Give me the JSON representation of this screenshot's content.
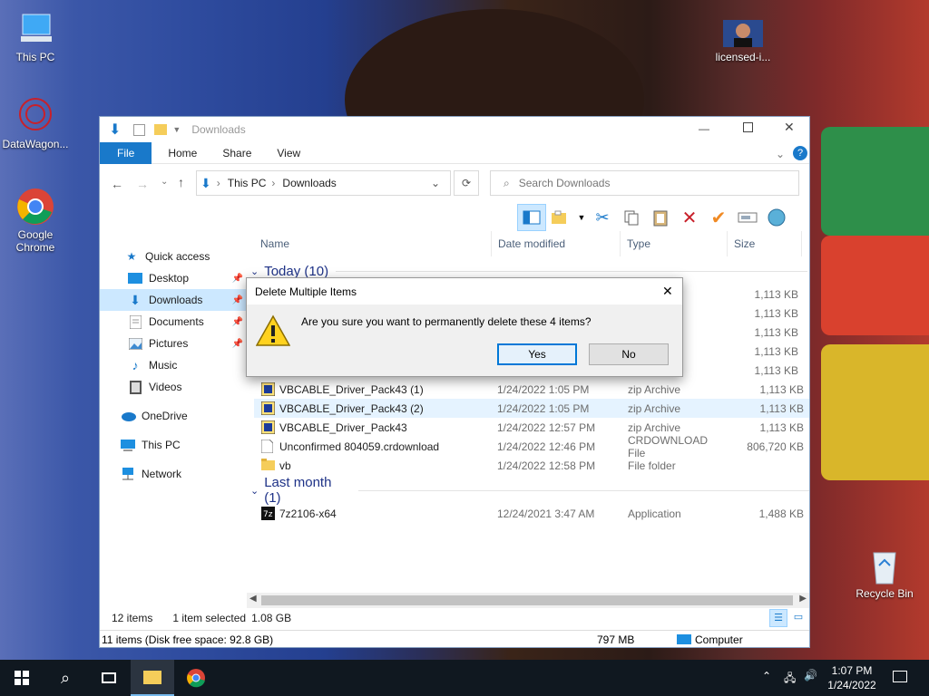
{
  "desktop": {
    "icons": [
      {
        "label": "This PC"
      },
      {
        "label": "DataWagon..."
      },
      {
        "label": "Google Chrome"
      },
      {
        "label": "licensed-i..."
      },
      {
        "label": "Recycle Bin"
      }
    ]
  },
  "explorer": {
    "title": "Downloads",
    "tabs": [
      "File",
      "Home",
      "Share",
      "View"
    ],
    "breadcrumb": [
      "This PC",
      "Downloads"
    ],
    "search_placeholder": "Search Downloads",
    "nav": [
      {
        "label": "Quick access",
        "icon": "star-icon"
      },
      {
        "label": "Desktop",
        "icon": "desktop-icon"
      },
      {
        "label": "Downloads",
        "icon": "download-icon"
      },
      {
        "label": "Documents",
        "icon": "documents-icon"
      },
      {
        "label": "Pictures",
        "icon": "pictures-icon"
      },
      {
        "label": "Music",
        "icon": "music-icon"
      },
      {
        "label": "Videos",
        "icon": "videos-icon"
      },
      {
        "label": "OneDrive",
        "icon": "cloud-icon"
      },
      {
        "label": "This PC",
        "icon": "computer-icon"
      },
      {
        "label": "Network",
        "icon": "network-icon"
      }
    ],
    "columns": [
      "Name",
      "Date modified",
      "Type",
      "Size"
    ],
    "group_today": "Today (10)",
    "group_last_month": "Last month (1)",
    "hidden_sizes": [
      "1,113 KB",
      "1,113 KB",
      "1,113 KB",
      "1,113 KB",
      "1,113 KB"
    ],
    "files": [
      {
        "name": "VBCABLE_Driver_Pack43 (1)",
        "date": "1/24/2022 1:05 PM",
        "type": "zip Archive",
        "size": "1,113 KB"
      },
      {
        "name": "VBCABLE_Driver_Pack43 (2)",
        "date": "1/24/2022 1:05 PM",
        "type": "zip Archive",
        "size": "1,113 KB"
      },
      {
        "name": "VBCABLE_Driver_Pack43",
        "date": "1/24/2022 12:57 PM",
        "type": "zip Archive",
        "size": "1,113 KB"
      },
      {
        "name": "Unconfirmed 804059.crdownload",
        "date": "1/24/2022 12:46 PM",
        "type": "CRDOWNLOAD File",
        "size": "806,720 KB"
      },
      {
        "name": "vb",
        "date": "1/24/2022 12:58 PM",
        "type": "File folder",
        "size": ""
      }
    ],
    "last_month_files": [
      {
        "name": "7z2106-x64",
        "date": "12/24/2021 3:47 AM",
        "type": "Application",
        "size": "1,488 KB"
      }
    ],
    "status": {
      "items": "12 items",
      "selected": "1 item selected",
      "selected_size": "1.08 GB",
      "disk": "11 items (Disk free space: 92.8 GB)",
      "free": "797 MB",
      "location": "Computer"
    }
  },
  "dialog": {
    "title": "Delete Multiple Items",
    "message": "Are you sure you want to permanently delete these 4 items?",
    "yes": "Yes",
    "no": "No"
  },
  "taskbar": {
    "time": "1:07 PM",
    "date": "1/24/2022"
  },
  "colors": {
    "accent": "#1979ca",
    "taskbar": "#101820"
  }
}
